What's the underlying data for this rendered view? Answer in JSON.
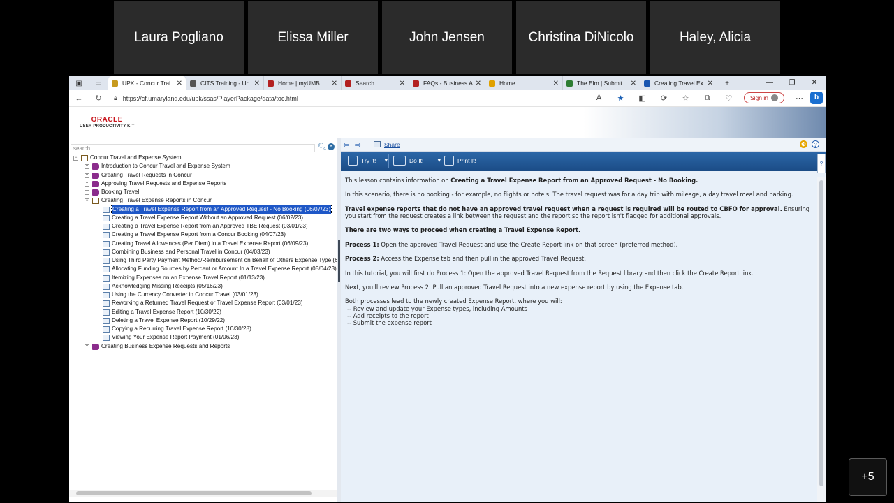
{
  "participants": [
    "Laura Pogliano",
    "Elissa Miller",
    "John Jensen",
    "Christina DiNicolo",
    "Haley, Alicia"
  ],
  "more_participants": "+5",
  "browser": {
    "tabs": [
      {
        "title": "UPK - Concur Trai",
        "color": "#c79a1f",
        "active": true
      },
      {
        "title": "CITS Training - Un",
        "color": "#555555",
        "active": false
      },
      {
        "title": "Home | myUMB",
        "color": "#b32121",
        "active": false
      },
      {
        "title": "Search",
        "color": "#b32121",
        "active": false
      },
      {
        "title": "FAQs - Business A",
        "color": "#b32121",
        "active": false
      },
      {
        "title": "Home",
        "color": "#e0a100",
        "active": false
      },
      {
        "title": "The Elm | Submit",
        "color": "#2e7d32",
        "active": false
      },
      {
        "title": "Creating Travel Ex",
        "color": "#1a56b0",
        "active": false
      }
    ],
    "new_tab": "+",
    "url": "https://cf.umaryland.edu/upk/ssas/PlayerPackage/data/toc.html",
    "signin": "Sign in"
  },
  "upk": {
    "brand_top": "ORACLE",
    "brand_bottom": "USER PRODUCTIVITY KIT",
    "search_placeholder": "search",
    "tree": [
      {
        "label": "Concur Travel and Expense System",
        "level": 0,
        "icon": "openbook",
        "exp": "−"
      },
      {
        "label": "Introduction to Concur Travel and Expense System",
        "level": 1,
        "icon": "book",
        "exp": "+"
      },
      {
        "label": "Creating Travel Requests in Concur",
        "level": 1,
        "icon": "book",
        "exp": "+"
      },
      {
        "label": "Approving Travel Requests and Expense Reports",
        "level": 1,
        "icon": "book",
        "exp": "+"
      },
      {
        "label": "Booking Travel",
        "level": 1,
        "icon": "book",
        "exp": "+"
      },
      {
        "label": "Creating Travel Expense Reports in Concur",
        "level": 1,
        "icon": "openbook",
        "exp": "−"
      },
      {
        "label": "Creating a Travel Expense Report from an Approved Request - No Booking (06/07/23)",
        "level": 2,
        "icon": "topic",
        "selected": true
      },
      {
        "label": "Creating a Travel Expense Report Without an Approved Request (06/02/23)",
        "level": 2,
        "icon": "topic"
      },
      {
        "label": "Creating a Travel Expense Report from an Approved TBE Request (03/01/23)",
        "level": 2,
        "icon": "topic"
      },
      {
        "label": "Creating a Travel Expense Report from a Concur Booking (04/07/23)",
        "level": 2,
        "icon": "topic"
      },
      {
        "label": "Creating Travel Allowances (Per Diem) in a Travel Expense Report (06/09/23)",
        "level": 2,
        "icon": "topic"
      },
      {
        "label": "Combining Business and Personal Travel in Concur (04/03/23)",
        "level": 2,
        "icon": "topic"
      },
      {
        "label": "Using Third Party Payment Method/Reimbursement on Behalf of Others Expense Type (6",
        "level": 2,
        "icon": "topic"
      },
      {
        "label": "Allocating Funding Sources by Percent or Amount In a Travel Expense Report (05/04/23)",
        "level": 2,
        "icon": "topic"
      },
      {
        "label": "Itemizing Expenses on an Expense Travel Report (01/13/23)",
        "level": 2,
        "icon": "topic"
      },
      {
        "label": "Acknowledging Missing Receipts (05/16/23)",
        "level": 2,
        "icon": "topic"
      },
      {
        "label": "Using the Currency Converter in Concur Travel (03/01/23)",
        "level": 2,
        "icon": "topic"
      },
      {
        "label": "Reworking a Returned Travel Request or Travel Expense Report (03/01/23)",
        "level": 2,
        "icon": "topic"
      },
      {
        "label": "Editing a Travel Expense Report (10/30/22)",
        "level": 2,
        "icon": "topic"
      },
      {
        "label": "Deleting a Travel Expense Report (10/29/22)",
        "level": 2,
        "icon": "topic"
      },
      {
        "label": "Copying a Recurring Travel Expense Report (10/30/28)",
        "level": 2,
        "icon": "topic"
      },
      {
        "label": "Viewing Your Expense Report Payment (01/06/23)",
        "level": 2,
        "icon": "topic"
      },
      {
        "label": "Creating Business Expense Requests and Reports",
        "level": 1,
        "icon": "book",
        "exp": "+"
      }
    ],
    "share": "Share",
    "modes": {
      "try": "Try It!",
      "do": "Do It!",
      "print": "Print It!"
    },
    "content": {
      "p1_pre": "This lesson contains information on ",
      "p1_bold": "Creating a Travel Expense Report from an Approved Request - No Booking.",
      "p2": "In this scenario, there is no booking - for example, no flights or hotels. The travel request was for a day trip with mileage, a day travel meal and parking.",
      "p3_underline": "Travel expense reports that do not have an approved travel request when a request is required will be routed to CBFO for approval.",
      "p3_rest": " Ensuring you start from the request creates a link between the request and the report so the report isn't flagged for additional approvals.",
      "p4": "There are two ways to proceed when creating a Travel Expense Report.",
      "p5_label": "Process 1:",
      "p5_text": " Open the approved Travel Request and use the Create Report link on that screen (preferred method).",
      "p6_label": "Process 2:",
      "p6_text": " Access the Expense tab and then pull in the approved Travel Request.",
      "p7": "In this tutorial, you will first do Process 1: Open the approved Travel Request from the Request library and then click the Create Report link.",
      "p8": "Next, you'll review Process 2: Pull an approved Travel Request into a new expense report by using the Expense tab.",
      "p9": "Both processes lead to the newly created Expense Report, where you will:",
      "bullets": [
        "--  Review and update your Expense types, including Amounts",
        "--  Add receipts to the report",
        "--  Submit the expense report"
      ]
    }
  }
}
